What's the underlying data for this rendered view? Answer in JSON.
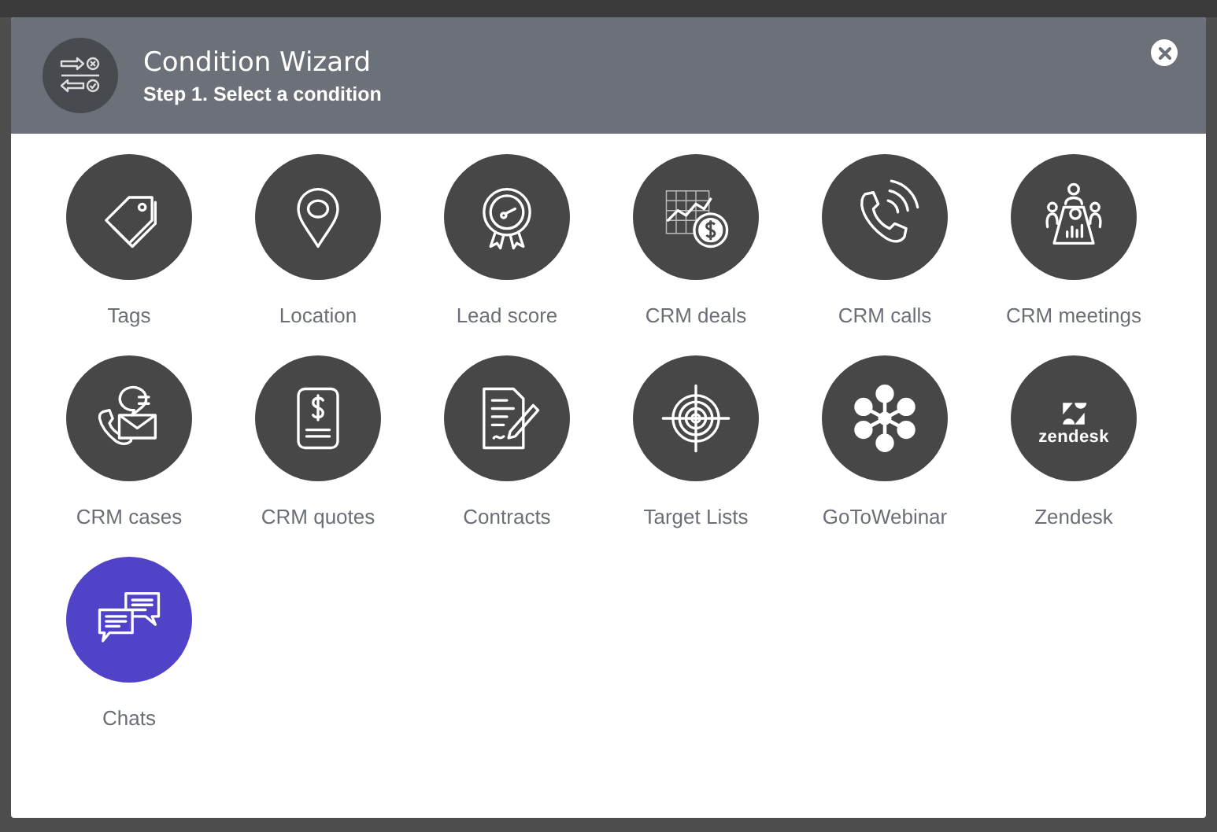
{
  "dialog": {
    "title": "Condition Wizard",
    "subtitle": "Step 1. Select a condition"
  },
  "conditions": [
    {
      "label": "Tags",
      "selected": false
    },
    {
      "label": "Location",
      "selected": false
    },
    {
      "label": "Lead score",
      "selected": false
    },
    {
      "label": "CRM deals",
      "selected": false
    },
    {
      "label": "CRM calls",
      "selected": false
    },
    {
      "label": "CRM meetings",
      "selected": false
    },
    {
      "label": "CRM cases",
      "selected": false
    },
    {
      "label": "CRM quotes",
      "selected": false
    },
    {
      "label": "Contracts",
      "selected": false
    },
    {
      "label": "Target Lists",
      "selected": false
    },
    {
      "label": "GoToWebinar",
      "selected": false
    },
    {
      "label": "Zendesk",
      "selected": false,
      "logo_text": "zendesk"
    },
    {
      "label": "Chats",
      "selected": true
    }
  ]
}
